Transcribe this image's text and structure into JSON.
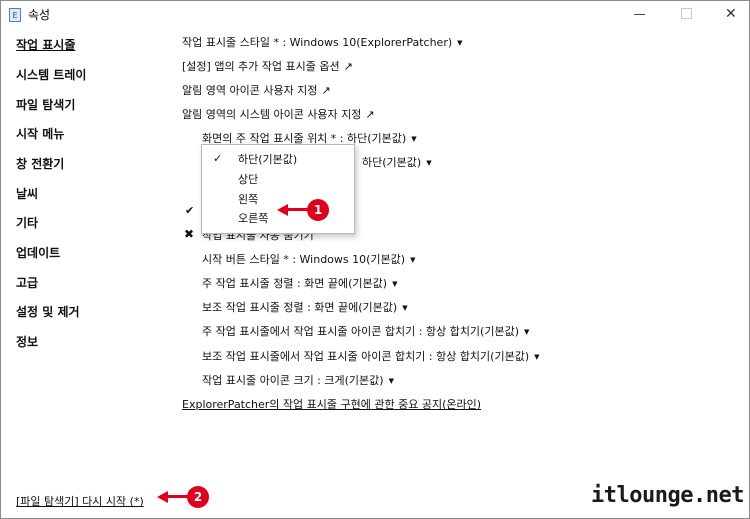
{
  "window": {
    "title": "속성",
    "app_icon": "window-icon",
    "close_glyph": "✕"
  },
  "sidebar": {
    "items": [
      {
        "label": "작업 표시줄"
      },
      {
        "label": "시스템 트레이"
      },
      {
        "label": "파일 탐색기"
      },
      {
        "label": "시작 메뉴"
      },
      {
        "label": "창 전환기"
      },
      {
        "label": "날씨"
      },
      {
        "label": "기타"
      },
      {
        "label": "업데이트"
      },
      {
        "label": "고급"
      },
      {
        "label": "설정 및 제거"
      },
      {
        "label": "정보"
      }
    ],
    "active_index": 0
  },
  "options": {
    "taskbar_style": "작업 표시줄 스타일 * : Windows 10(ExplorerPatcher)",
    "app_extra_taskbar": "[설정] 앱의 추가 작업 표시줄 옵션",
    "notify_icons": "알림 영역 아이콘 사용자 지정",
    "notify_system_icons": "알림 영역의 시스템 아이콘 사용자 지정",
    "primary_position": "화면의 주 작업 표시줄 위치 * : 하단(기본값)",
    "secondary_position_value": "하단(기본값)",
    "taskbar_toggle_partial": "작업 표시줄 자동 숨기기",
    "start_button_style": "시작 버튼 스타일 * : Windows 10(기본값)",
    "primary_alignment": "주 작업 표시줄 정렬 : 화면 끝에(기본값)",
    "secondary_alignment": "보조 작업 표시줄 정렬 : 화면 끝에(기본값)",
    "primary_combine": "주 작업 표시줄에서 작업 표시줄 아이콘 합치기 : 항상 합치기(기본값)",
    "secondary_combine": "보조 작업 표시줄에서 작업 표시줄 아이콘 합치기 : 항상 합치기(기본값)",
    "icon_size": "작업 표시줄 아이콘 크기 : 크게(기본값)",
    "notice_link": "ExplorerPatcher의 작업 표시줄 구현에 관한 중요 공지(온라인)"
  },
  "dropdown": {
    "items": [
      "하단(기본값)",
      "상단",
      "왼쪽",
      "오른쪽"
    ],
    "checked_index": 0
  },
  "footer": {
    "restart_link": "[파일 탐색기] 다시 시작 (*)"
  },
  "callouts": [
    "1",
    "2"
  ],
  "watermark": "itlounge.net",
  "colors": {
    "callout_red": "#e0001b"
  }
}
